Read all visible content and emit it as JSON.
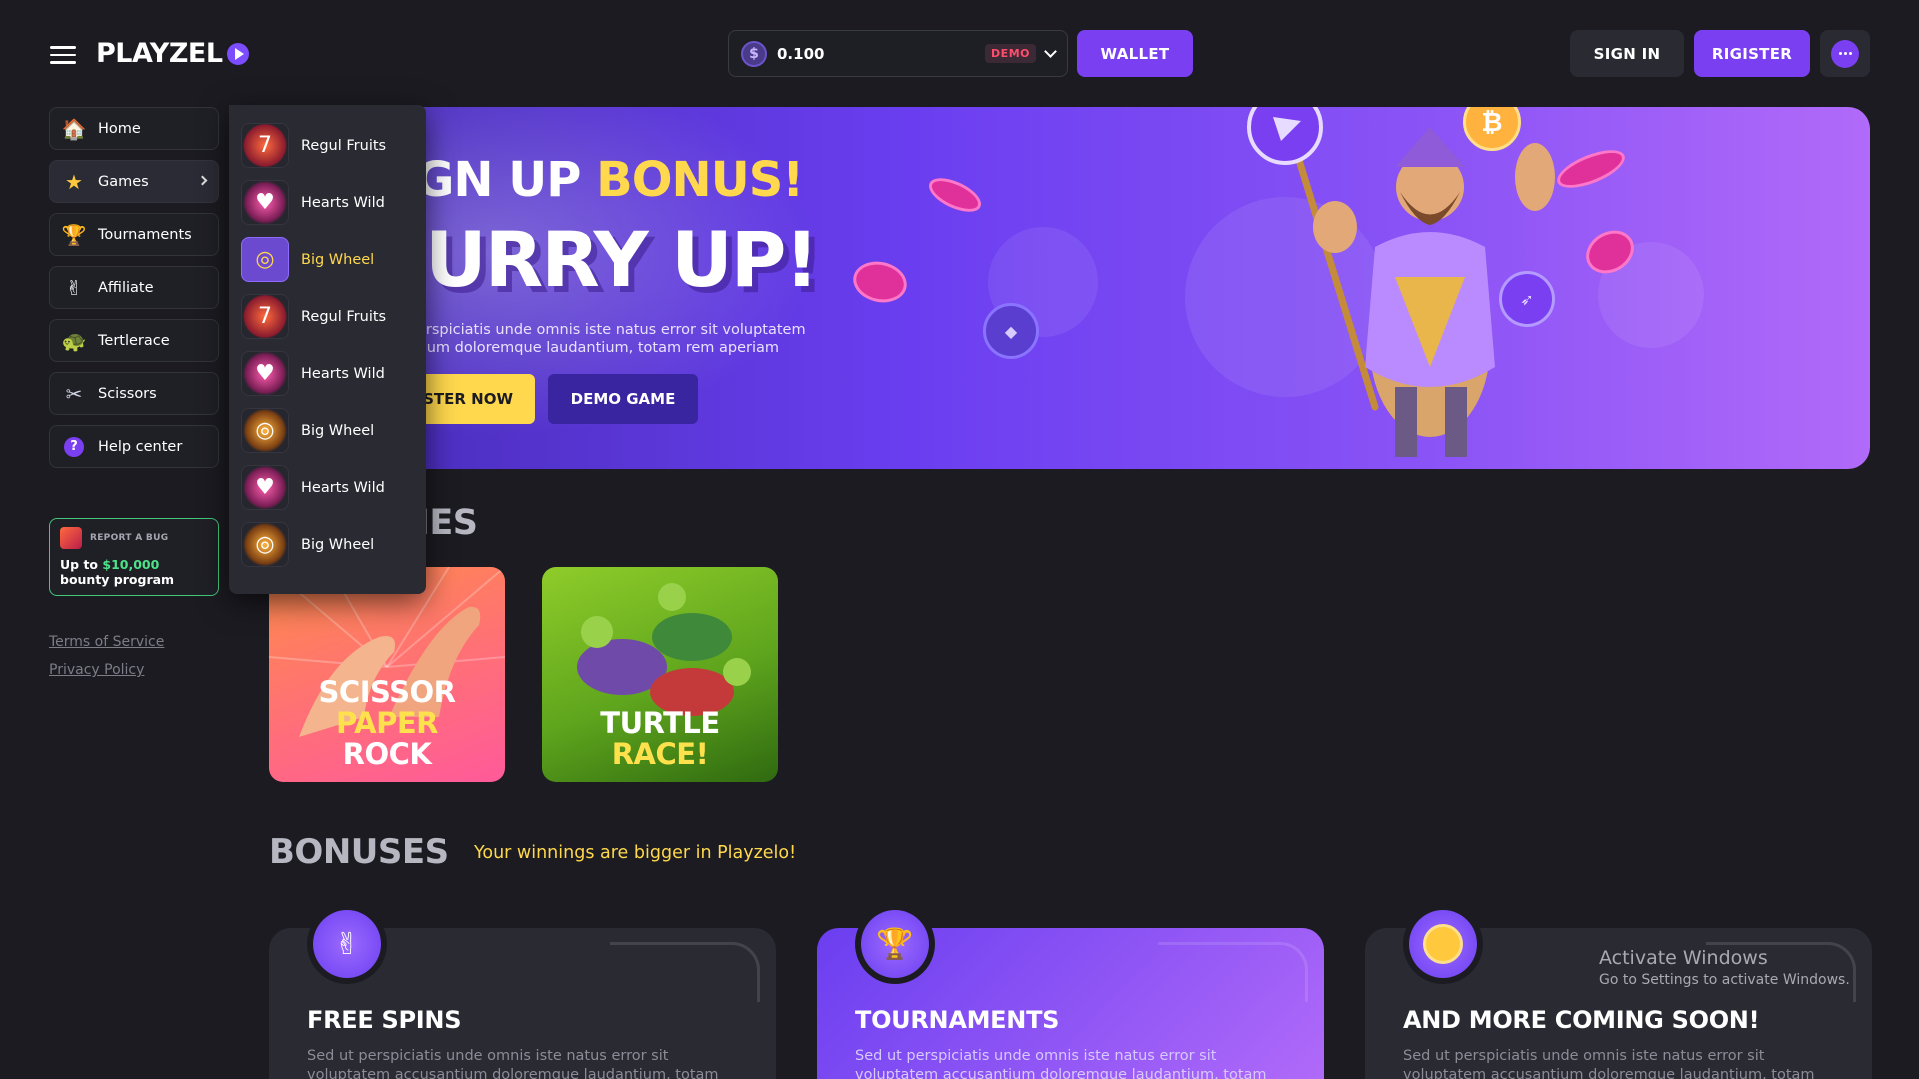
{
  "header": {
    "logo_text": "PLAYZEL",
    "balance": {
      "currency_icon": "$",
      "value": "0.100",
      "mode_badge": "DEMO"
    },
    "wallet_label": "WALLET",
    "signin_label": "SIGN IN",
    "register_label": "RIGISTER"
  },
  "sidebar": {
    "items": [
      {
        "label": "Home",
        "icon": "home-icon"
      },
      {
        "label": "Games",
        "icon": "star-icon"
      },
      {
        "label": "Tournaments",
        "icon": "trophy-icon"
      },
      {
        "label": "Affiliate",
        "icon": "hand-icon"
      },
      {
        "label": "Tertlerace",
        "icon": "turtle-icon"
      },
      {
        "label": "Scissors",
        "icon": "scissors-icon"
      },
      {
        "label": "Help center",
        "icon": "help-icon"
      }
    ],
    "bug_card": {
      "label": "REPORT A BUG",
      "text_prefix": "Up to ",
      "amount": "$10,000",
      "text_suffix": " bounty program"
    },
    "links": [
      "Terms of Service",
      "Privacy Policy"
    ]
  },
  "games_menu": {
    "items": [
      {
        "label": "Regul Fruits",
        "thumb": "fruits"
      },
      {
        "label": "Hearts Wild",
        "thumb": "hearts"
      },
      {
        "label": "Big Wheel",
        "thumb": "wheel",
        "selected": true
      },
      {
        "label": "Regul Fruits",
        "thumb": "fruits"
      },
      {
        "label": "Hearts Wild",
        "thumb": "hearts"
      },
      {
        "label": "Big Wheel",
        "thumb": "wheel"
      },
      {
        "label": "Hearts Wild",
        "thumb": "hearts"
      },
      {
        "label": "Big Wheel",
        "thumb": "wheel"
      }
    ]
  },
  "hero": {
    "line1_white": "GN UP ",
    "line1_yellow": "BONUS!",
    "line2": "URRY UP!",
    "description": "erspiciatis unde omnis iste natus error sit voluptatem\ntium doloremque laudantium, totam rem aperiam",
    "register_label": "STER NOW",
    "demo_label": "DEMO GAME"
  },
  "games_section": {
    "title": "MES",
    "cards": [
      {
        "line1": "SCISSOR",
        "line2": "PAPER",
        "line3": "ROCK"
      },
      {
        "line1": "TURTLE",
        "line2": "RACE!"
      }
    ]
  },
  "bonuses": {
    "title": "BONUSES",
    "subtitle": "Your winnings are bigger in Playzelo!",
    "cards": [
      {
        "title": "FREE SPINS",
        "desc": "Sed ut perspiciatis unde omnis iste natus error sit voluptatem accusantium doloremque laudantium, totam",
        "style": "dark",
        "icon": "hand-icon"
      },
      {
        "title": "TOURNAMENTS",
        "desc": "Sed ut perspiciatis unde omnis iste natus error sit voluptatem accusantium doloremque laudantium, totam",
        "style": "purple",
        "icon": "trophy-icon"
      },
      {
        "title": "AND MORE COMING SOON!",
        "desc": "Sed ut perspiciatis unde omnis iste natus error sit voluptatem accusantium doloremque laudantium, totam",
        "style": "dark",
        "icon": "coin-icon"
      }
    ]
  },
  "os_watermark": {
    "line1": "Activate Windows",
    "line2": "Go to Settings to activate Windows."
  },
  "colors": {
    "accent": "#7b3ff2",
    "yellow": "#ffd84d",
    "green": "#4ee38a",
    "background": "#1b1b21"
  }
}
